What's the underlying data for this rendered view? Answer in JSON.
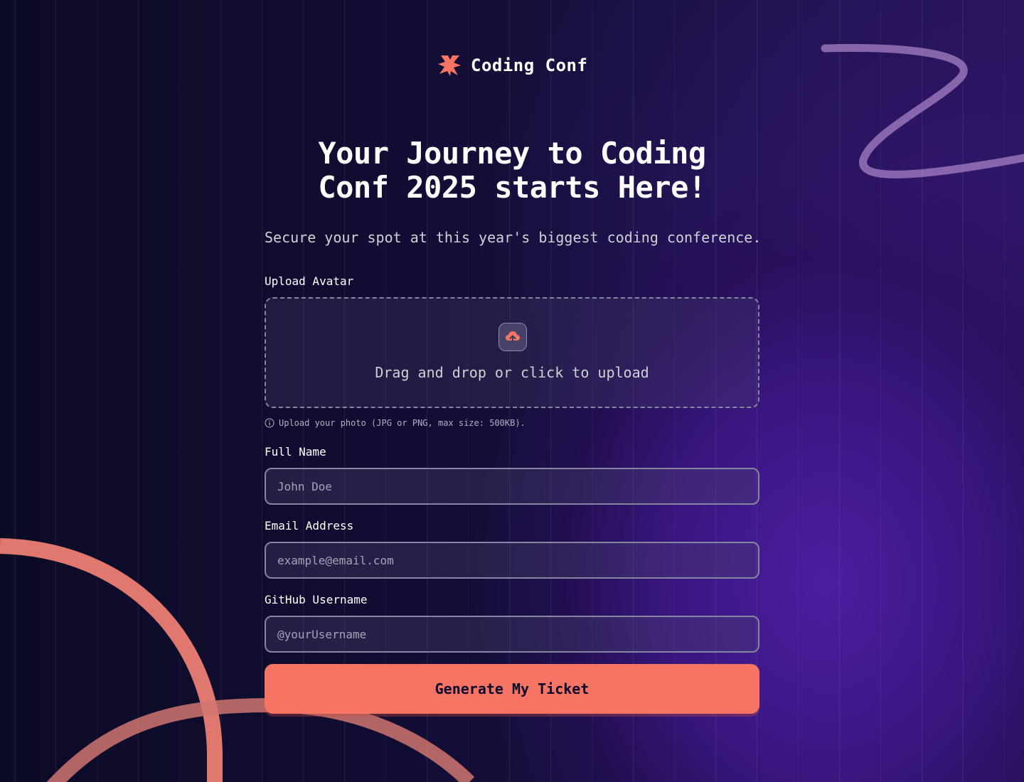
{
  "brand": {
    "name": "Coding Conf",
    "accent": "#f57463"
  },
  "hero": {
    "title": "Your Journey to Coding Conf 2025 starts Here!",
    "subtitle": "Secure your spot at this year's biggest coding conference."
  },
  "form": {
    "avatar": {
      "label": "Upload Avatar",
      "dropzone_text": "Drag and drop or click to upload",
      "hint": "Upload your photo (JPG or PNG, max size: 500KB).",
      "icon": "upload-cloud-icon",
      "hint_icon": "info-icon"
    },
    "full_name": {
      "label": "Full Name",
      "placeholder": "John Doe",
      "value": ""
    },
    "email": {
      "label": "Email Address",
      "placeholder": "example@email.com",
      "value": ""
    },
    "github": {
      "label": "GitHub Username",
      "placeholder": "@yourUsername",
      "value": ""
    },
    "submit_label": "Generate My Ticket"
  }
}
